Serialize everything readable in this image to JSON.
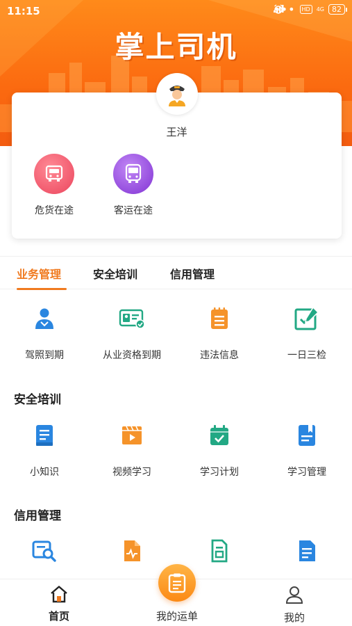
{
  "status_bar": {
    "time": "11:15",
    "dots": "•••",
    "hd": "HD",
    "network": "4G",
    "battery": "82"
  },
  "app_title": "掌上司机",
  "profile": {
    "name": "王洋",
    "quick_actions": [
      {
        "label": "危货在途",
        "icon": "truck-icon",
        "color": "#f25b6d"
      },
      {
        "label": "客运在途",
        "icon": "bus-icon",
        "color": "#9a55e0"
      }
    ]
  },
  "tabs": [
    {
      "label": "业务管理",
      "active": true
    },
    {
      "label": "安全培训",
      "active": false
    },
    {
      "label": "信用管理",
      "active": false
    }
  ],
  "business": {
    "items": [
      {
        "label": "驾照到期",
        "icon": "driver-license-icon"
      },
      {
        "label": "从业资格到期",
        "icon": "id-card-icon"
      },
      {
        "label": "违法信息",
        "icon": "violation-notes-icon"
      },
      {
        "label": "一日三检",
        "icon": "edit-check-icon"
      }
    ]
  },
  "training": {
    "title": "安全培训",
    "items": [
      {
        "label": "小知识",
        "icon": "knowledge-book-icon"
      },
      {
        "label": "视频学习",
        "icon": "video-icon"
      },
      {
        "label": "学习计划",
        "icon": "calendar-check-icon"
      },
      {
        "label": "学习管理",
        "icon": "study-book-icon"
      }
    ]
  },
  "credit": {
    "title": "信用管理",
    "items": [
      {
        "label": "",
        "icon": "search-card-icon"
      },
      {
        "label": "",
        "icon": "report-pulse-icon"
      },
      {
        "label": "",
        "icon": "record-doc-icon"
      },
      {
        "label": "",
        "icon": "document-icon"
      }
    ]
  },
  "bottom_nav": {
    "home": "首页",
    "orders": "我的运单",
    "mine": "我的"
  },
  "colors": {
    "accent": "#f07a1f",
    "blue": "#2a86e0",
    "orange": "#f5932a",
    "green": "#22a884"
  }
}
